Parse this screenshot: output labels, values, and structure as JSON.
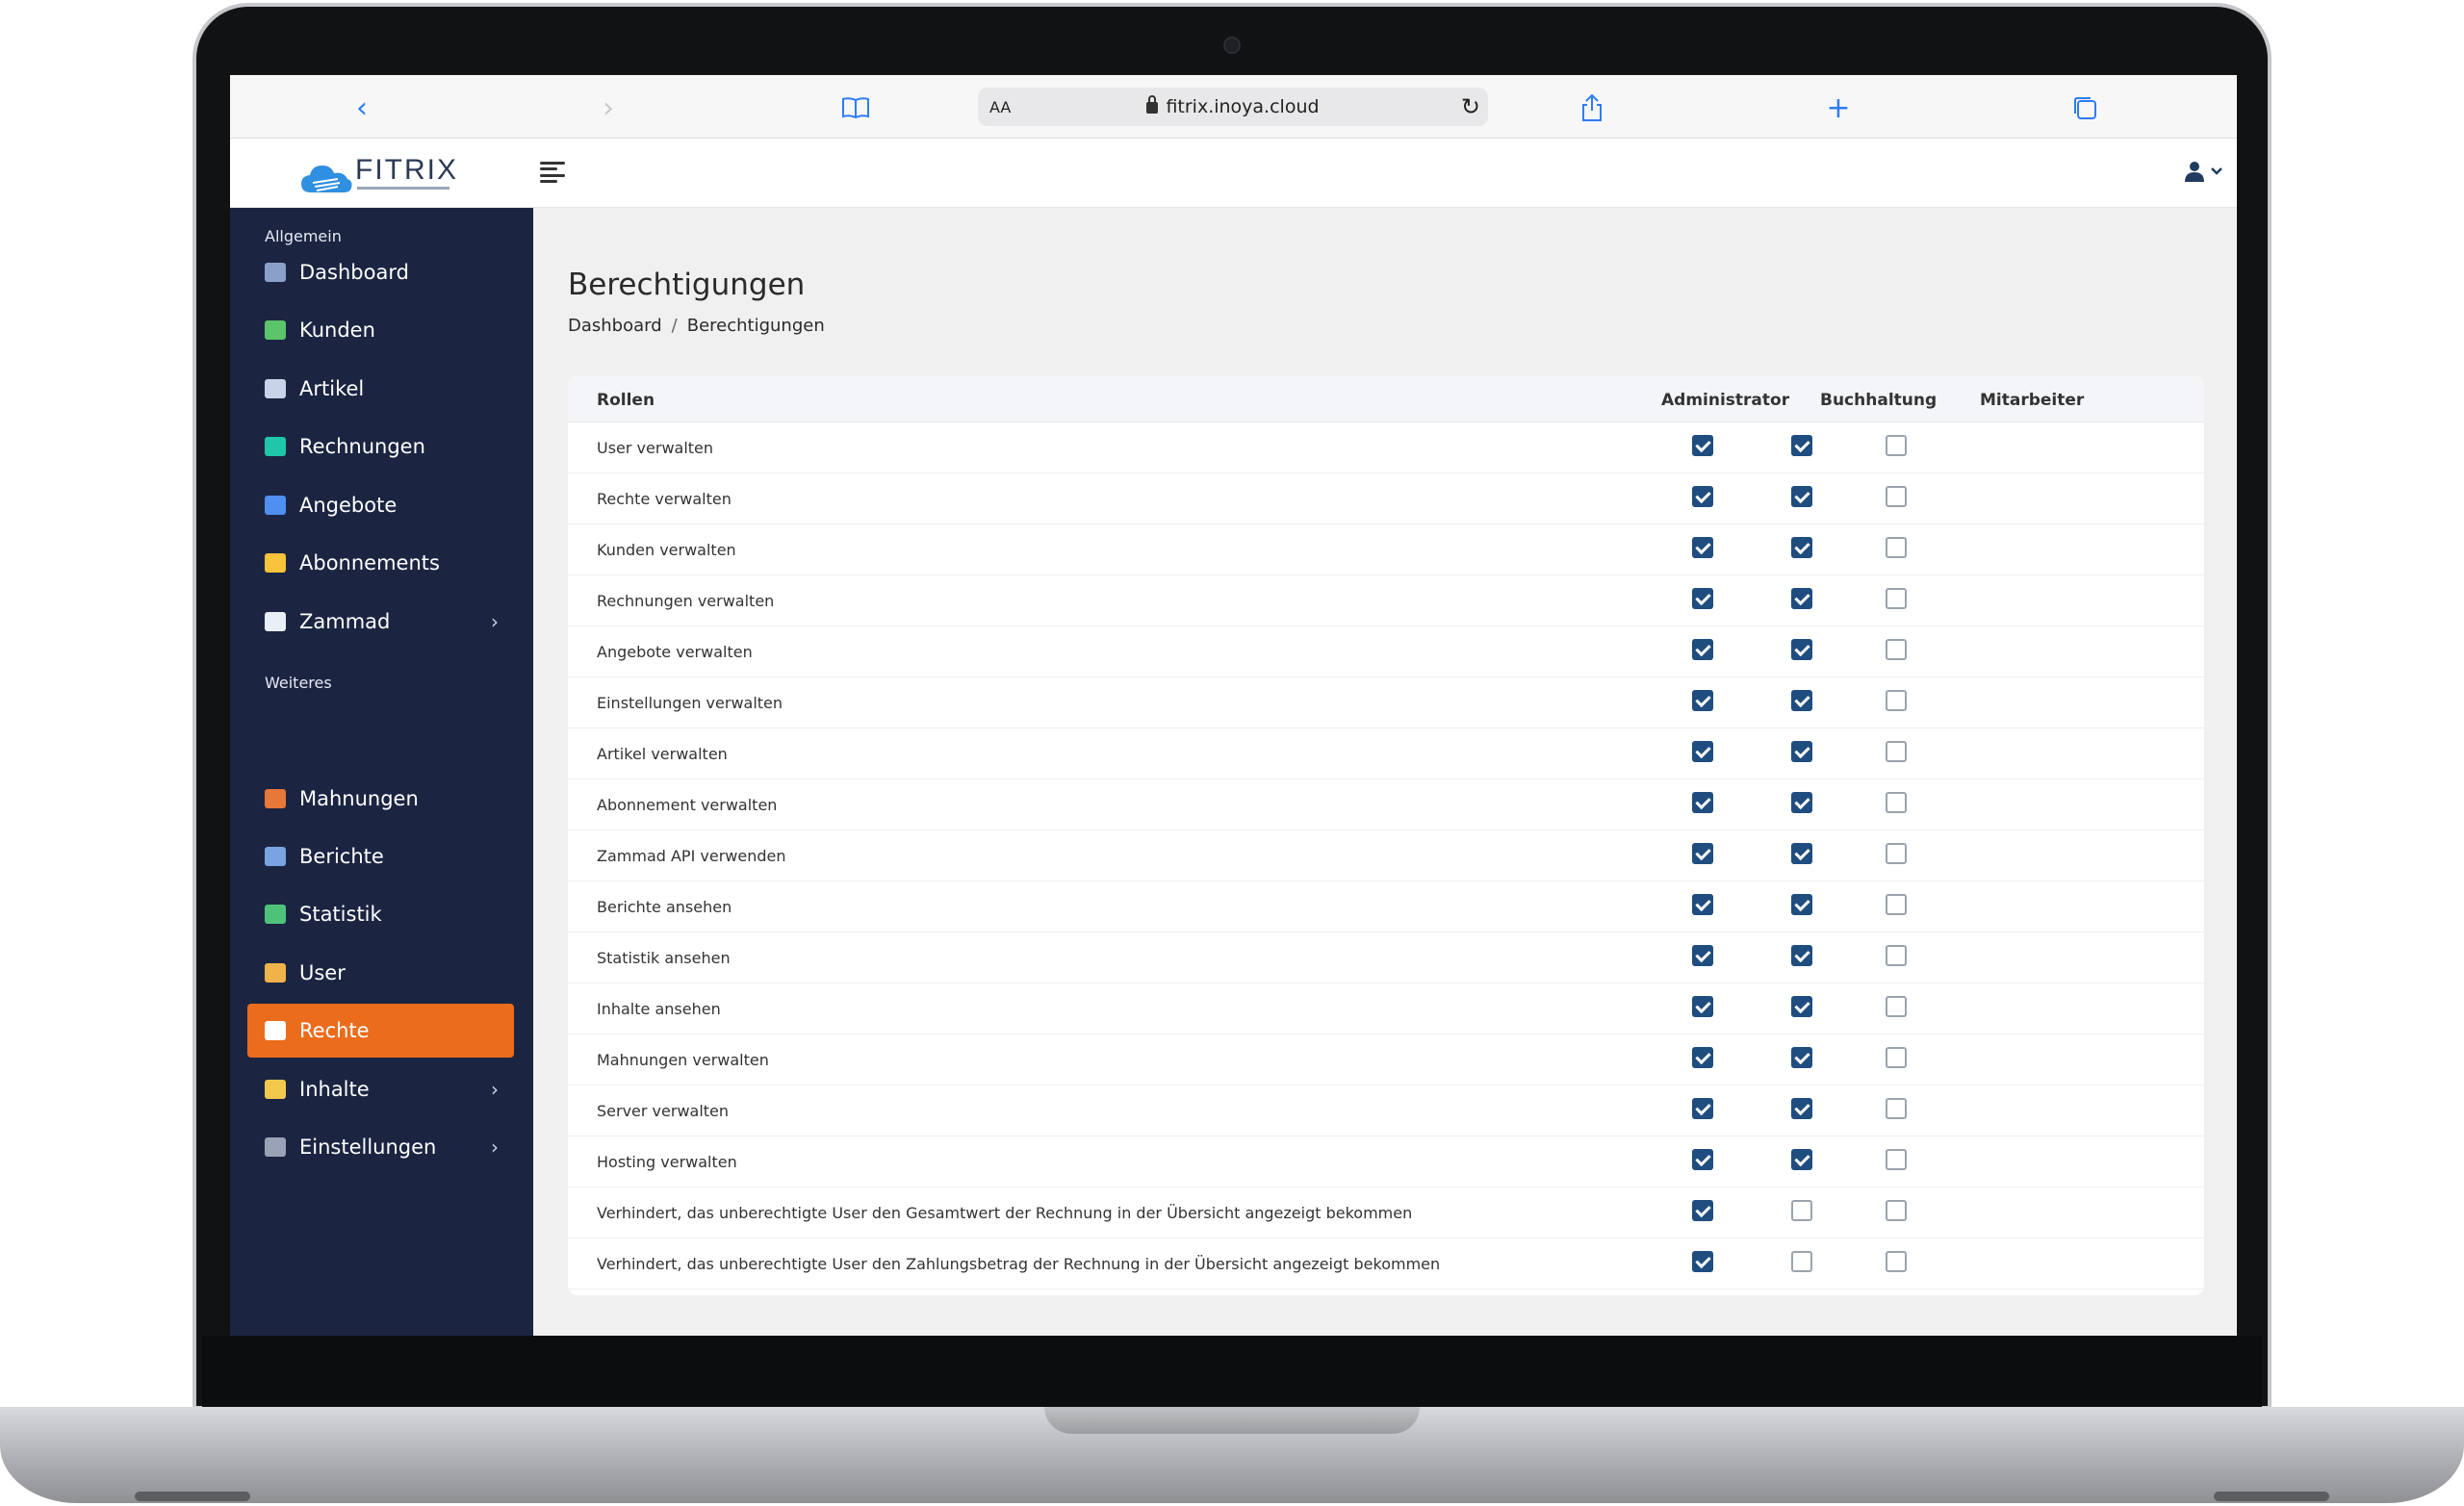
{
  "browser": {
    "aa_label": "AA",
    "url": "fitrix.inoya.cloud",
    "accent_color": "#2f7cf6"
  },
  "header": {
    "logo_text": "FITRIX",
    "icons": [
      "menu-icon",
      "user-icon",
      "chevron-down-icon"
    ]
  },
  "sidebar": {
    "background": "#1b2542",
    "active_color": "#ec6c1d",
    "section_general": "Allgemein",
    "section_more": "Weiteres",
    "items": [
      {
        "label": "Dashboard",
        "icon": "dashboard-icon",
        "active": false
      },
      {
        "label": "Kunden",
        "icon": "customers-icon",
        "active": false
      },
      {
        "label": "Artikel",
        "icon": "articles-icon",
        "active": false
      },
      {
        "label": "Rechnungen",
        "icon": "invoices-icon",
        "active": false
      },
      {
        "label": "Angebote",
        "icon": "offers-icon",
        "active": false
      },
      {
        "label": "Abonnements",
        "icon": "bell-icon",
        "active": false
      },
      {
        "label": "Zammad",
        "icon": "zammad-icon",
        "active": false
      },
      {
        "label": "Mahnungen",
        "icon": "reminders-icon",
        "active": false
      },
      {
        "label": "Berichte",
        "icon": "reports-icon",
        "active": false
      },
      {
        "label": "Statistik",
        "icon": "statistics-icon",
        "active": false
      },
      {
        "label": "User",
        "icon": "user-icon",
        "active": false
      },
      {
        "label": "Rechte",
        "icon": "rights-icon",
        "active": true
      },
      {
        "label": "Inhalte",
        "icon": "contents-icon",
        "active": false
      },
      {
        "label": "Einstellungen",
        "icon": "settings-icon",
        "active": false
      }
    ]
  },
  "page": {
    "title": "Berechtigungen",
    "breadcrumb_home": "Dashboard",
    "breadcrumb_sep": "/",
    "breadcrumb_current": "Berechtigungen"
  },
  "table": {
    "headers": [
      "Rollen",
      "Administrator",
      "Buchhaltung",
      "Mitarbeiter"
    ],
    "rows": [
      {
        "label": "User verwalten",
        "admin": true,
        "buchhaltung": true,
        "mitarbeiter": false
      },
      {
        "label": "Rechte verwalten",
        "admin": true,
        "buchhaltung": true,
        "mitarbeiter": false
      },
      {
        "label": "Kunden verwalten",
        "admin": true,
        "buchhaltung": true,
        "mitarbeiter": false
      },
      {
        "label": "Rechnungen verwalten",
        "admin": true,
        "buchhaltung": true,
        "mitarbeiter": false
      },
      {
        "label": "Angebote verwalten",
        "admin": true,
        "buchhaltung": true,
        "mitarbeiter": false
      },
      {
        "label": "Einstellungen verwalten",
        "admin": true,
        "buchhaltung": true,
        "mitarbeiter": false
      },
      {
        "label": "Artikel verwalten",
        "admin": true,
        "buchhaltung": true,
        "mitarbeiter": false
      },
      {
        "label": "Abonnement verwalten",
        "admin": true,
        "buchhaltung": true,
        "mitarbeiter": false
      },
      {
        "label": "Zammad API verwenden",
        "admin": true,
        "buchhaltung": true,
        "mitarbeiter": false
      },
      {
        "label": "Berichte ansehen",
        "admin": true,
        "buchhaltung": true,
        "mitarbeiter": false
      },
      {
        "label": "Statistik ansehen",
        "admin": true,
        "buchhaltung": true,
        "mitarbeiter": false
      },
      {
        "label": "Inhalte ansehen",
        "admin": true,
        "buchhaltung": true,
        "mitarbeiter": false
      },
      {
        "label": "Mahnungen verwalten",
        "admin": true,
        "buchhaltung": true,
        "mitarbeiter": false
      },
      {
        "label": "Server verwalten",
        "admin": true,
        "buchhaltung": true,
        "mitarbeiter": false
      },
      {
        "label": "Hosting verwalten",
        "admin": true,
        "buchhaltung": true,
        "mitarbeiter": false
      },
      {
        "label": "Verhindert, das unberechtigte User den Gesamtwert der Rechnung in der Übersicht angezeigt bekommen",
        "admin": true,
        "buchhaltung": false,
        "mitarbeiter": false
      },
      {
        "label": "Verhindert, das unberechtigte User den Zahlungsbetrag der Rechnung in der Übersicht angezeigt bekommen",
        "admin": true,
        "buchhaltung": false,
        "mitarbeiter": false
      }
    ],
    "checked_color": "#1f4d7f"
  }
}
